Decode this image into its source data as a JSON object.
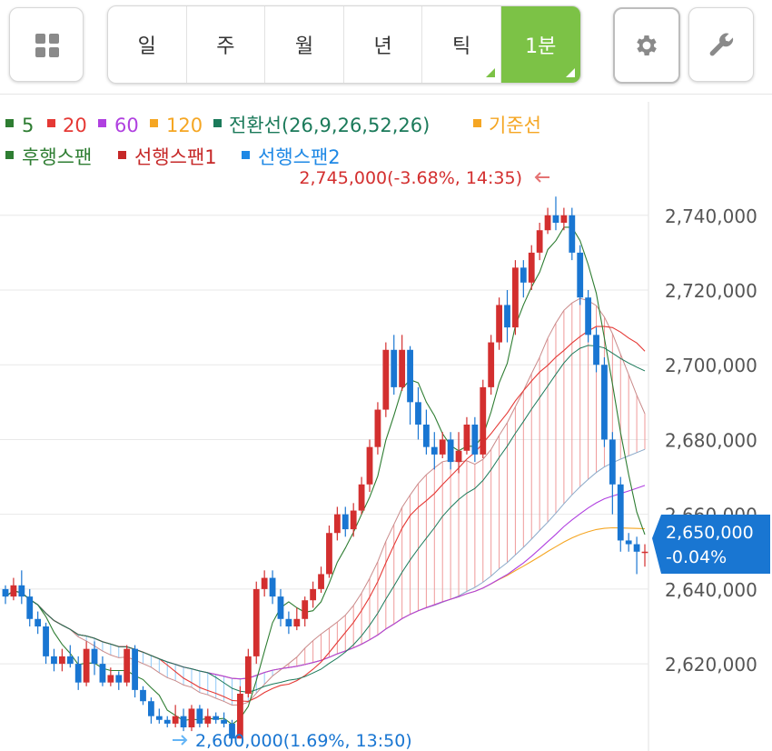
{
  "toolbar": {
    "periods": [
      {
        "label": "일",
        "active": false,
        "has_dropdown": false
      },
      {
        "label": "주",
        "active": false,
        "has_dropdown": false
      },
      {
        "label": "월",
        "active": false,
        "has_dropdown": false
      },
      {
        "label": "년",
        "active": false,
        "has_dropdown": false
      },
      {
        "label": "틱",
        "active": false,
        "has_dropdown": true
      },
      {
        "label": "1분",
        "active": true,
        "has_dropdown": true
      }
    ],
    "left_icon": "grid-icon",
    "right_icons": [
      "gear-icon",
      "wrench-icon"
    ]
  },
  "legend": {
    "row1": [
      {
        "label": "5",
        "color": "#2e7d32"
      },
      {
        "label": "20",
        "color": "#e53935"
      },
      {
        "label": "60",
        "color": "#b040e0"
      },
      {
        "label": "120",
        "color": "#f5a623"
      },
      {
        "label": "전환선(26,9,26,52,26)",
        "color": "#1b7a5a"
      },
      {
        "label": "기준선",
        "color": "#f5a623"
      }
    ],
    "row2": [
      {
        "label": "후행스팬",
        "color": "#2e7d32"
      },
      {
        "label": "선행스팬1",
        "color": "#c62828"
      },
      {
        "label": "선행스팬2",
        "color": "#1e88e5"
      }
    ]
  },
  "annotations": {
    "high": "2,745,000(-3.68%, 14:35)",
    "low": "2,600,000(1.69%, 13:50)"
  },
  "current": {
    "price": "2,650,000",
    "change": "-0.04%"
  },
  "colors": {
    "up": "#d32f2f",
    "down": "#1976d2",
    "accent": "#7cc246",
    "price_tag": "#1976d2",
    "high_label": "#d32f2f",
    "low_label": "#1976d2"
  },
  "chart_data": {
    "type": "candlestick",
    "ylim": [
      2603000,
      2747000
    ],
    "y_ticks": [
      {
        "value": 2740000,
        "label": "2,740,000"
      },
      {
        "value": 2720000,
        "label": "2,720,000"
      },
      {
        "value": 2700000,
        "label": "2,700,000"
      },
      {
        "value": 2680000,
        "label": "2,680,000"
      },
      {
        "value": 2660000,
        "label": "2,660,000"
      },
      {
        "value": 2640000,
        "label": "2,640,000"
      },
      {
        "value": 2620000,
        "label": "2,620,000"
      }
    ],
    "candles": [
      [
        2640000,
        2638000,
        2641000,
        2636000
      ],
      [
        2638000,
        2641000,
        2643000,
        2637000
      ],
      [
        2641000,
        2638000,
        2645000,
        2636000
      ],
      [
        2638000,
        2632000,
        2640000,
        2630000
      ],
      [
        2632000,
        2630000,
        2634000,
        2628000
      ],
      [
        2630000,
        2622000,
        2631000,
        2620000
      ],
      [
        2622000,
        2620000,
        2624000,
        2618000
      ],
      [
        2620000,
        2622000,
        2624000,
        2618000
      ],
      [
        2622000,
        2620000,
        2625000,
        2619000
      ],
      [
        2620000,
        2615000,
        2622000,
        2613000
      ],
      [
        2615000,
        2624000,
        2626000,
        2614000
      ],
      [
        2624000,
        2620000,
        2626000,
        2617000
      ],
      [
        2620000,
        2615000,
        2622000,
        2614000
      ],
      [
        2615000,
        2617000,
        2619000,
        2614000
      ],
      [
        2617000,
        2615000,
        2618000,
        2613000
      ],
      [
        2615000,
        2624000,
        2625000,
        2614000
      ],
      [
        2624000,
        2613000,
        2625000,
        2611000
      ],
      [
        2613000,
        2610000,
        2614000,
        2609000
      ],
      [
        2610000,
        2606000,
        2611000,
        2604000
      ],
      [
        2606000,
        2605000,
        2608000,
        2604000
      ],
      [
        2605000,
        2604000,
        2606000,
        2603000
      ],
      [
        2604000,
        2606000,
        2609000,
        2603000
      ],
      [
        2606000,
        2603000,
        2608000,
        2602000
      ],
      [
        2603000,
        2608000,
        2609000,
        2602000
      ],
      [
        2608000,
        2604000,
        2609000,
        2603000
      ],
      [
        2604000,
        2606000,
        2608000,
        2603000
      ],
      [
        2606000,
        2605000,
        2607000,
        2604000
      ],
      [
        2605000,
        2604000,
        2607000,
        2603000
      ],
      [
        2604000,
        2600000,
        2605000,
        2600000
      ],
      [
        2600000,
        2612000,
        2614000,
        2600000
      ],
      [
        2612000,
        2622000,
        2624000,
        2611000
      ],
      [
        2622000,
        2640000,
        2642000,
        2620000
      ],
      [
        2640000,
        2643000,
        2645000,
        2638000
      ],
      [
        2643000,
        2638000,
        2645000,
        2636000
      ],
      [
        2638000,
        2632000,
        2640000,
        2630000
      ],
      [
        2632000,
        2630000,
        2634000,
        2628000
      ],
      [
        2630000,
        2632000,
        2635000,
        2629000
      ],
      [
        2632000,
        2637000,
        2638000,
        2630000
      ],
      [
        2637000,
        2640000,
        2642000,
        2635000
      ],
      [
        2640000,
        2644000,
        2646000,
        2639000
      ],
      [
        2644000,
        2655000,
        2657000,
        2643000
      ],
      [
        2655000,
        2660000,
        2662000,
        2653000
      ],
      [
        2660000,
        2656000,
        2662000,
        2654000
      ],
      [
        2656000,
        2661000,
        2663000,
        2654000
      ],
      [
        2661000,
        2668000,
        2670000,
        2660000
      ],
      [
        2668000,
        2678000,
        2680000,
        2666000
      ],
      [
        2678000,
        2688000,
        2690000,
        2676000
      ],
      [
        2688000,
        2704000,
        2706000,
        2686000
      ],
      [
        2704000,
        2694000,
        2708000,
        2692000
      ],
      [
        2694000,
        2704000,
        2708000,
        2693000
      ],
      [
        2704000,
        2690000,
        2705000,
        2684000
      ],
      [
        2690000,
        2684000,
        2694000,
        2680000
      ],
      [
        2684000,
        2678000,
        2688000,
        2676000
      ],
      [
        2678000,
        2676000,
        2682000,
        2672000
      ],
      [
        2676000,
        2680000,
        2682000,
        2675000
      ],
      [
        2680000,
        2674000,
        2682000,
        2672000
      ],
      [
        2674000,
        2677000,
        2682000,
        2671000
      ],
      [
        2677000,
        2684000,
        2686000,
        2676000
      ],
      [
        2684000,
        2676000,
        2686000,
        2674000
      ],
      [
        2676000,
        2694000,
        2696000,
        2675000
      ],
      [
        2694000,
        2706000,
        2708000,
        2692000
      ],
      [
        2706000,
        2716000,
        2718000,
        2704000
      ],
      [
        2716000,
        2710000,
        2720000,
        2706000
      ],
      [
        2710000,
        2726000,
        2728000,
        2708000
      ],
      [
        2726000,
        2722000,
        2728000,
        2718000
      ],
      [
        2722000,
        2730000,
        2732000,
        2720000
      ],
      [
        2730000,
        2736000,
        2738000,
        2728000
      ],
      [
        2736000,
        2740000,
        2742000,
        2735000
      ],
      [
        2740000,
        2738000,
        2745000,
        2736000
      ],
      [
        2738000,
        2740000,
        2742000,
        2736000
      ],
      [
        2740000,
        2730000,
        2742000,
        2728000
      ],
      [
        2730000,
        2718000,
        2732000,
        2716000
      ],
      [
        2718000,
        2708000,
        2720000,
        2706000
      ],
      [
        2708000,
        2700000,
        2710000,
        2698000
      ],
      [
        2700000,
        2680000,
        2702000,
        2678000
      ],
      [
        2680000,
        2668000,
        2682000,
        2660000
      ],
      [
        2668000,
        2653000,
        2670000,
        2650000
      ],
      [
        2653000,
        2652000,
        2655000,
        2650000
      ],
      [
        2652000,
        2650000,
        2654000,
        2644000
      ],
      [
        2650000,
        2650000,
        2652000,
        2646000
      ]
    ]
  }
}
